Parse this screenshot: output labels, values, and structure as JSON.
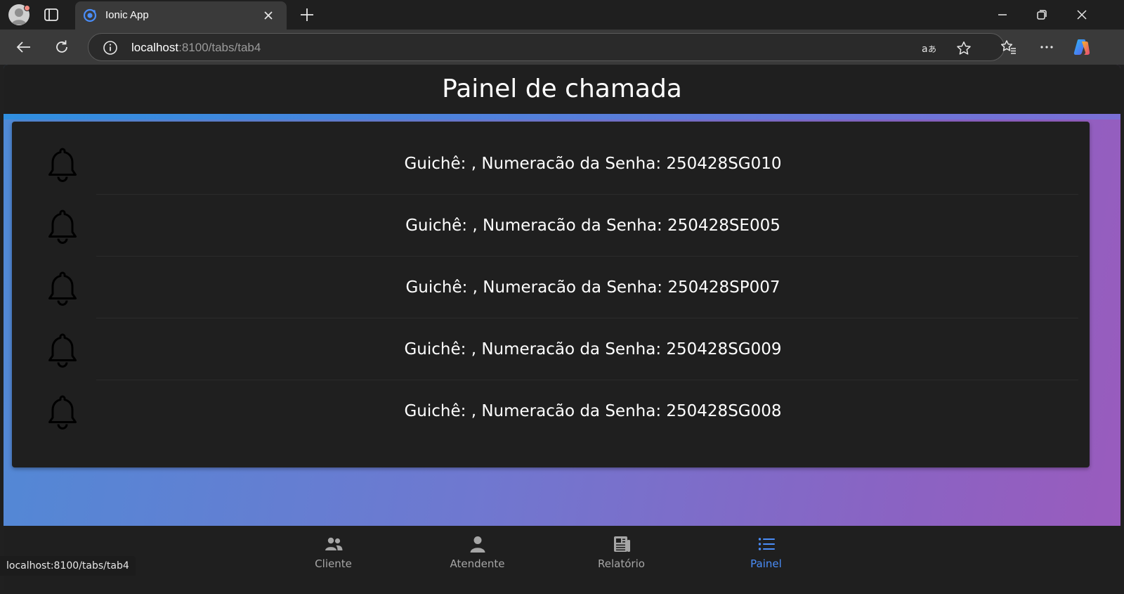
{
  "browser": {
    "tab": {
      "title": "Ionic App"
    },
    "url": {
      "host": "localhost",
      "rest": ":8100/tabs/tab4"
    },
    "status_url": "localhost:8100/tabs/tab4",
    "icons": [
      "profile-avatar-icon",
      "tab-actions-icon",
      "ionic-favicon-icon",
      "close-icon",
      "plus-icon",
      "minimize-icon",
      "restore-icon",
      "window-close-icon",
      "back-icon",
      "reload-icon",
      "info-icon",
      "translate-icon",
      "star-icon",
      "favorites-icon",
      "more-icon",
      "copilot-icon"
    ]
  },
  "app": {
    "header": {
      "title": "Painel de chamada"
    },
    "calls": [
      {
        "text": "Guichê: , Numeracão da Senha: 250428SG010"
      },
      {
        "text": "Guichê: , Numeracão da Senha: 250428SE005"
      },
      {
        "text": "Guichê: , Numeracão da Senha: 250428SP007"
      },
      {
        "text": "Guichê: , Numeracão da Senha: 250428SG009"
      },
      {
        "text": "Guichê: , Numeracão da Senha: 250428SG008"
      }
    ],
    "tabs": [
      {
        "label": "Cliente",
        "icon": "people-icon"
      },
      {
        "label": "Atendente",
        "icon": "person-icon"
      },
      {
        "label": "Relatório",
        "icon": "newspaper-icon"
      },
      {
        "label": "Painel",
        "icon": "list-icon",
        "active": true
      }
    ],
    "colors": {
      "accent": "#4a8df8",
      "gradient_start": "#4f8ad6",
      "gradient_end": "#9a5bbd",
      "surface": "#1f1f1f"
    }
  }
}
